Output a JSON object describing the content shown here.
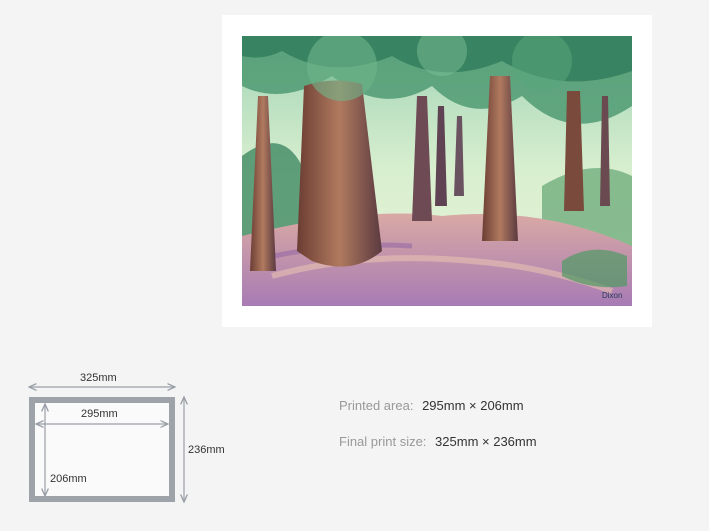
{
  "diagram": {
    "outer_width": "325mm",
    "inner_width": "295mm",
    "outer_height": "236mm",
    "inner_height": "206mm"
  },
  "specs": [
    {
      "label": "Printed area:",
      "value": "295mm × 206mm"
    },
    {
      "label": "Final print size:",
      "value": "325mm × 236mm"
    }
  ],
  "artwork": {
    "signature": "Dixon"
  }
}
